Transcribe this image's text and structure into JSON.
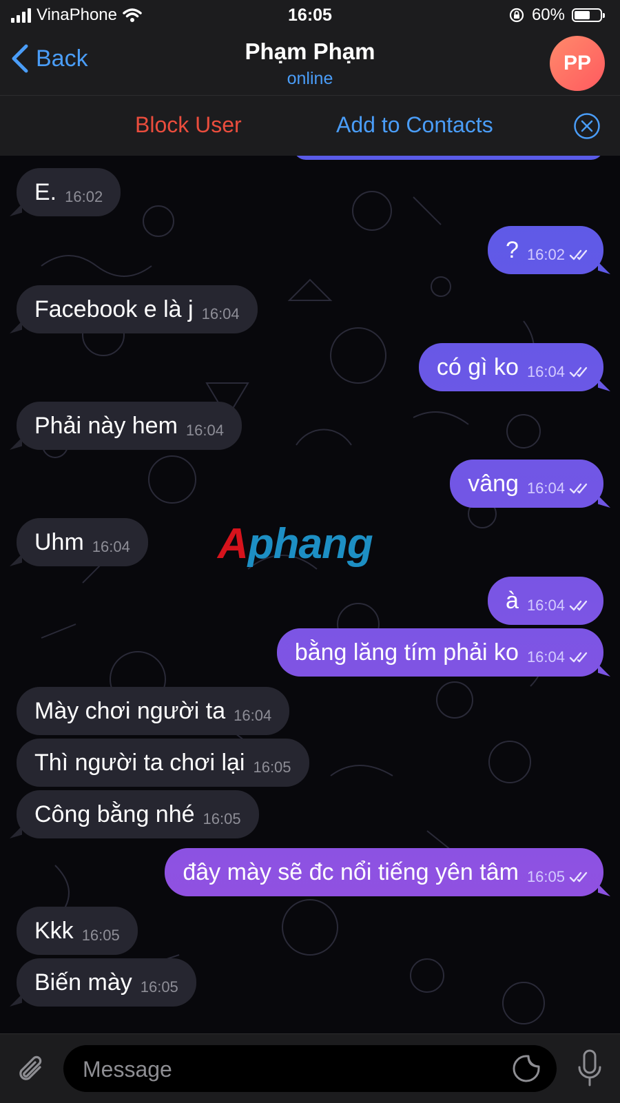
{
  "status_bar": {
    "carrier": "VinaPhone",
    "time": "16:05",
    "battery": "60%",
    "battery_level": 0.6,
    "icons": [
      "signal-bars-icon",
      "wifi-icon",
      "rotation-lock-icon",
      "battery-icon"
    ]
  },
  "header": {
    "back_label": "Back",
    "title": "Phạm Phạm",
    "subtitle": "online",
    "avatar_initials": "PP",
    "avatar_colors": [
      "#ff8a6b",
      "#ff5a5f"
    ]
  },
  "action_bar": {
    "block_label": "Block User",
    "add_label": "Add to Contacts",
    "close_icon": "close-circle-icon"
  },
  "messages": [
    {
      "text": "E.",
      "time": "16:02",
      "direction": "in"
    },
    {
      "text": "?",
      "time": "16:02",
      "direction": "out",
      "read": true
    },
    {
      "text": "Facebook e là j",
      "time": "16:04",
      "direction": "in"
    },
    {
      "text": "có gì ko",
      "time": "16:04",
      "direction": "out",
      "read": true
    },
    {
      "text": "Phải này hem",
      "time": "16:04",
      "direction": "in"
    },
    {
      "text": "vâng",
      "time": "16:04",
      "direction": "out",
      "read": true
    },
    {
      "text": "Uhm",
      "time": "16:04",
      "direction": "in"
    },
    {
      "text": "à",
      "time": "16:04",
      "direction": "out",
      "read": true
    },
    {
      "text": "bằng lăng tím phải ko",
      "time": "16:04",
      "direction": "out",
      "read": true
    },
    {
      "text": "Mày chơi người ta",
      "time": "16:04",
      "direction": "in"
    },
    {
      "text": "Thì người ta chơi lại",
      "time": "16:05",
      "direction": "in"
    },
    {
      "text": "Công bằng nhé",
      "time": "16:05",
      "direction": "in"
    },
    {
      "text": "đây mày sẽ đc nổi tiếng yên tâm",
      "time": "16:05",
      "direction": "out",
      "read": true
    },
    {
      "text": "Kkk",
      "time": "16:05",
      "direction": "in"
    },
    {
      "text": "Biến mày",
      "time": "16:05",
      "direction": "in"
    }
  ],
  "watermark": {
    "first": "A",
    "rest": "phang"
  },
  "input_bar": {
    "placeholder": "Message",
    "icons": [
      "paperclip-icon",
      "sticker-icon",
      "microphone-icon"
    ]
  },
  "colors": {
    "accent_blue": "#4a9df8",
    "block_red": "#eb4d3d",
    "incoming_bubble": "#262630",
    "outgoing_bubble_top": "#5a5be8",
    "outgoing_bubble_bottom": "#9a4fe0"
  }
}
